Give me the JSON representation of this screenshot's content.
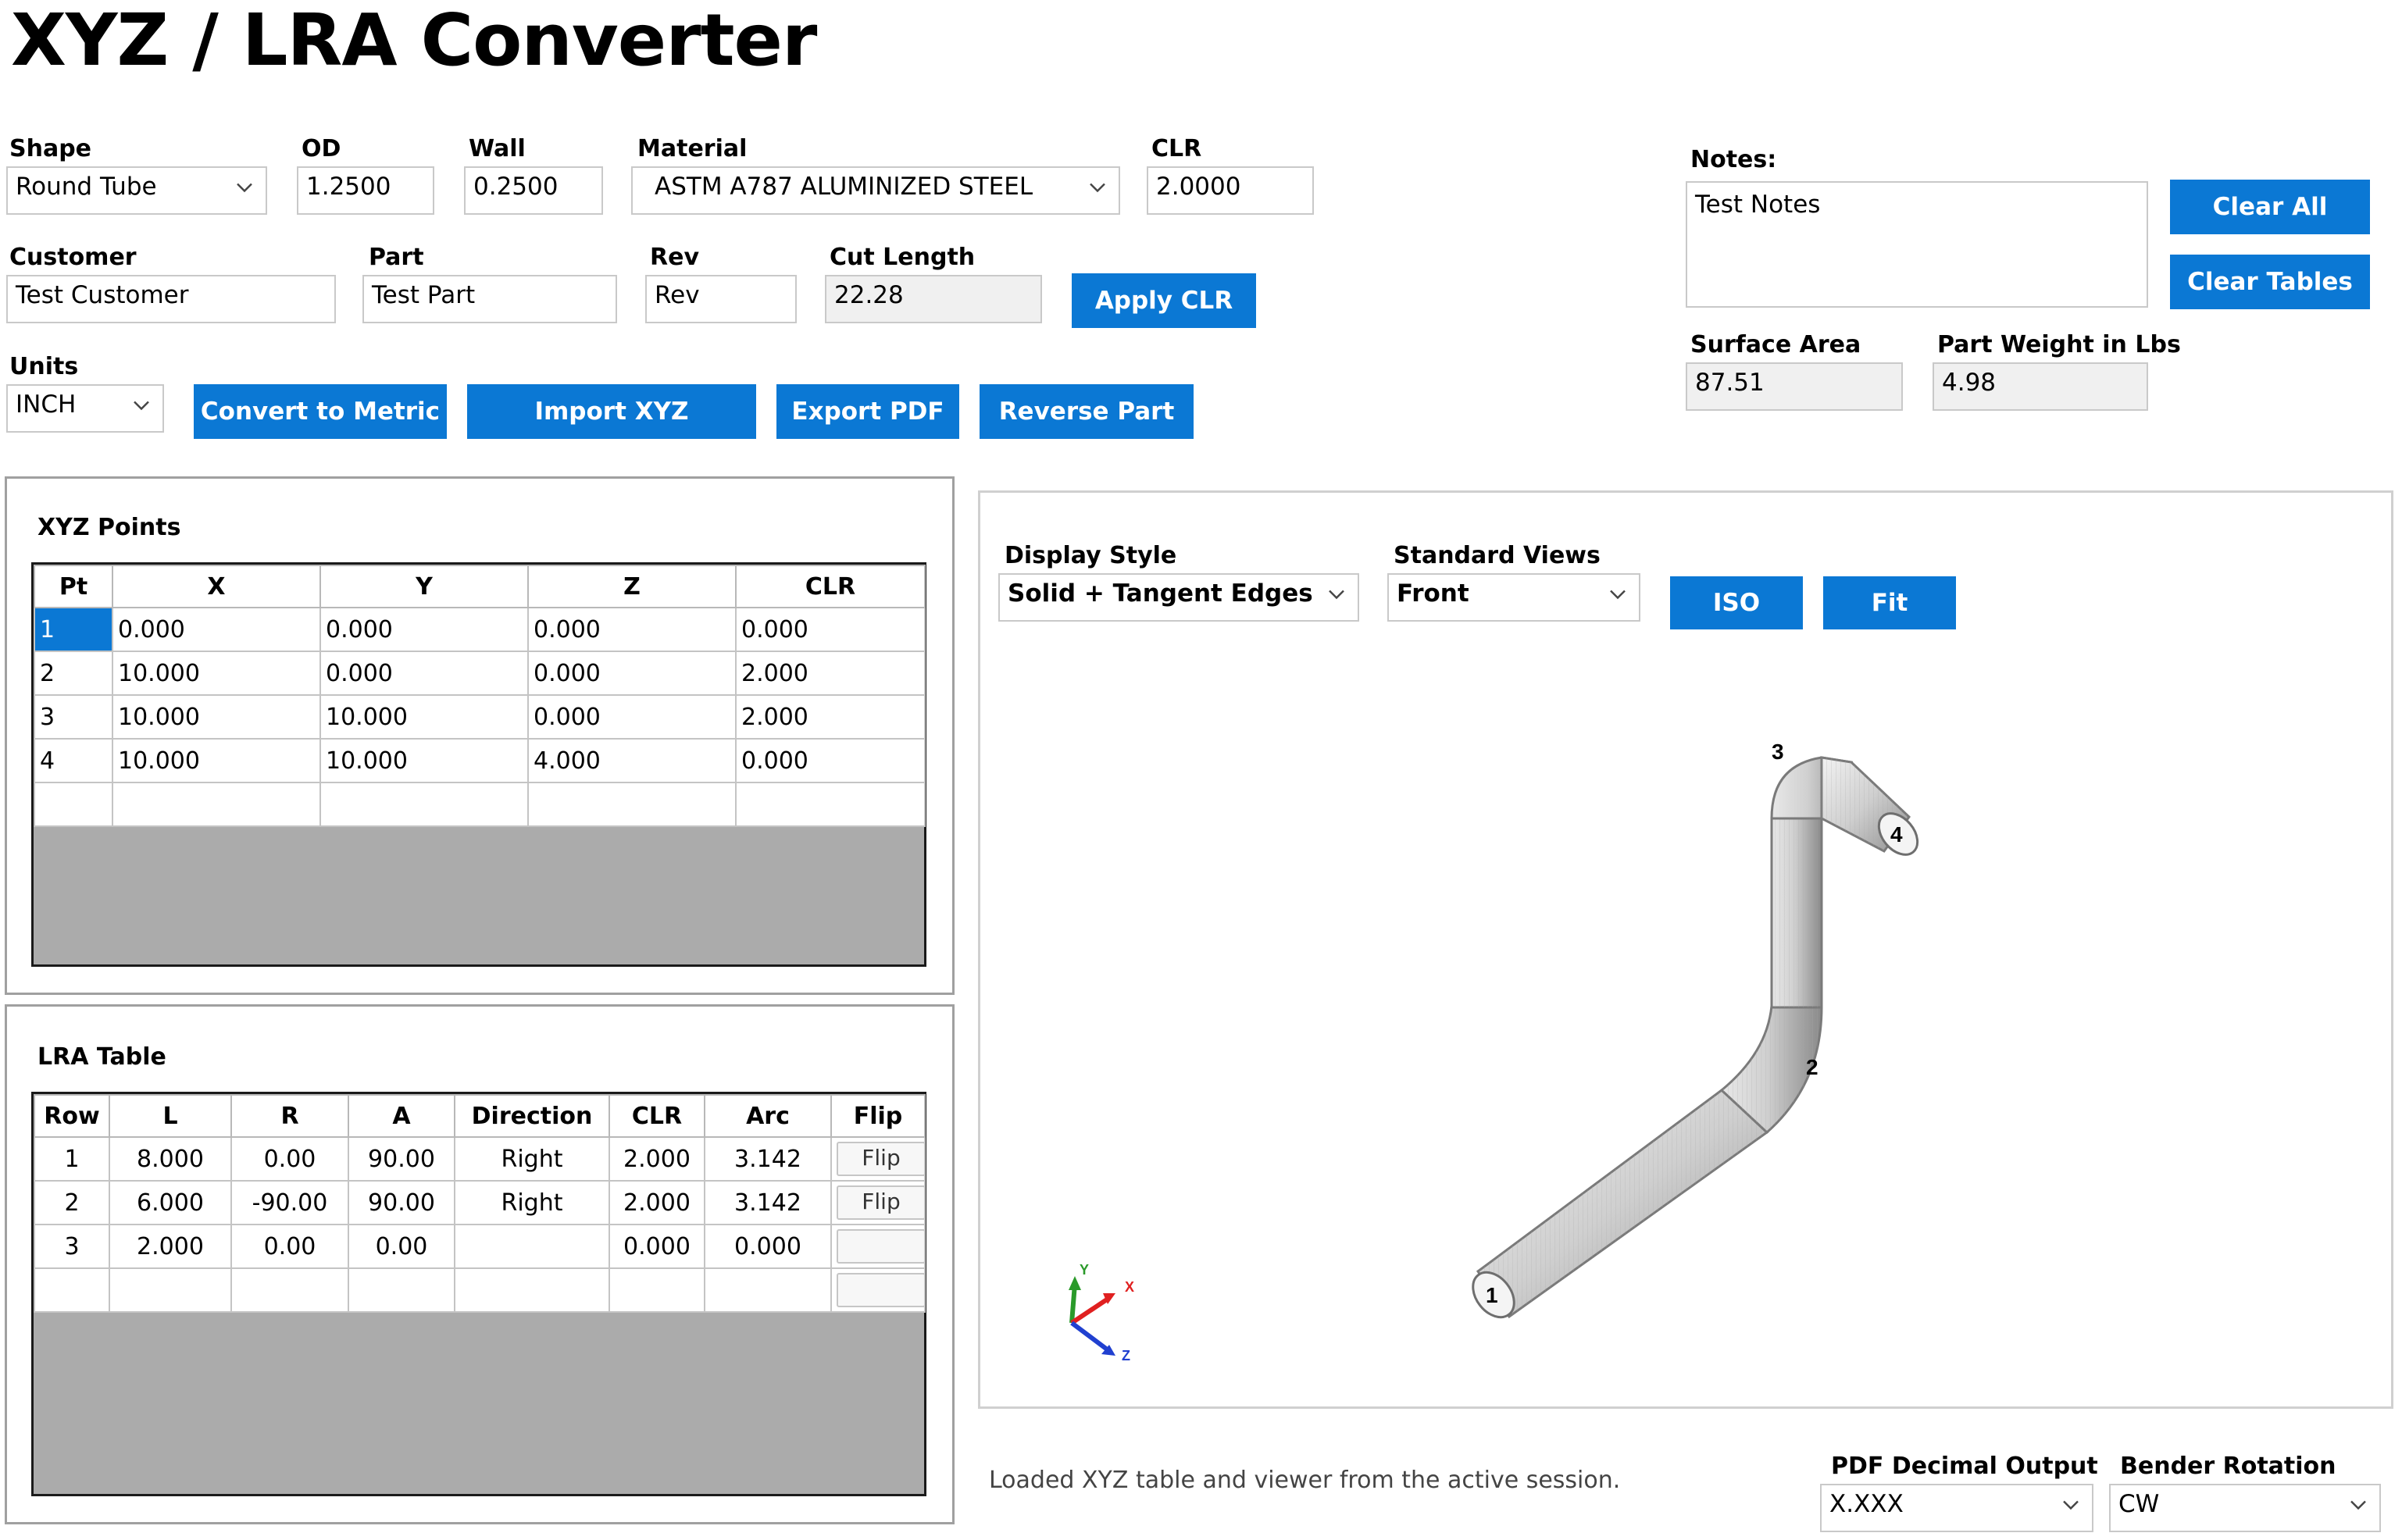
{
  "app": {
    "title": "XYZ / LRA Converter"
  },
  "form": {
    "shape": {
      "label": "Shape",
      "value": "Round Tube"
    },
    "od": {
      "label": "OD",
      "value": "1.2500"
    },
    "wall": {
      "label": "Wall",
      "value": "0.2500"
    },
    "material": {
      "label": "Material",
      "value": "ASTM A787 ALUMINIZED STEEL"
    },
    "clr": {
      "label": "CLR",
      "value": "2.0000"
    },
    "customer": {
      "label": "Customer",
      "value": "Test Customer"
    },
    "part": {
      "label": "Part",
      "value": "Test Part"
    },
    "rev": {
      "label": "Rev",
      "value": "Rev"
    },
    "cut_length": {
      "label": "Cut Length",
      "value": "22.28"
    },
    "units": {
      "label": "Units",
      "value": "INCH"
    }
  },
  "buttons": {
    "apply_clr": "Apply CLR",
    "convert_metric": "Convert to Metric",
    "import_xyz": "Import XYZ",
    "export_pdf": "Export PDF",
    "reverse_part": "Reverse Part",
    "clear_all": "Clear All",
    "clear_tables": "Clear Tables",
    "iso": "ISO",
    "fit": "Fit"
  },
  "notes": {
    "label": "Notes:",
    "value": "Test Notes"
  },
  "surface_area": {
    "label": "Surface Area",
    "value": "87.51"
  },
  "part_weight": {
    "label": "Part Weight in Lbs",
    "value": "4.98"
  },
  "xyz_table": {
    "title": "XYZ Points",
    "headers": [
      "Pt",
      "X",
      "Y",
      "Z",
      "CLR"
    ],
    "rows": [
      [
        "1",
        "0.000",
        "0.000",
        "0.000",
        "0.000"
      ],
      [
        "2",
        "10.000",
        "0.000",
        "0.000",
        "2.000"
      ],
      [
        "3",
        "10.000",
        "10.000",
        "0.000",
        "2.000"
      ],
      [
        "4",
        "10.000",
        "10.000",
        "4.000",
        "0.000"
      ]
    ]
  },
  "lra_table": {
    "title": "LRA Table",
    "headers": [
      "Row",
      "L",
      "R",
      "A",
      "Direction",
      "CLR",
      "Arc",
      "Flip"
    ],
    "rows": [
      {
        "cells": [
          "1",
          "8.000",
          "0.00",
          "90.00",
          "Right",
          "2.000",
          "3.142"
        ],
        "flip": "Flip"
      },
      {
        "cells": [
          "2",
          "6.000",
          "-90.00",
          "90.00",
          "Right",
          "2.000",
          "3.142"
        ],
        "flip": "Flip"
      },
      {
        "cells": [
          "3",
          "2.000",
          "0.00",
          "0.00",
          "",
          "0.000",
          "0.000"
        ],
        "flip": ""
      }
    ]
  },
  "viewer": {
    "display_style": {
      "label": "Display Style",
      "value": "Solid + Tangent Edges"
    },
    "standard_views": {
      "label": "Standard Views",
      "value": "Front"
    },
    "point_labels": [
      "1",
      "2",
      "3",
      "4"
    ],
    "axes": {
      "x": "X",
      "y": "Y",
      "z": "Z"
    }
  },
  "status": {
    "text": "Loaded XYZ table and viewer from the active session."
  },
  "pdf_decimal": {
    "label": "PDF Decimal Output",
    "value": "X.XXX"
  },
  "bender_rotation": {
    "label": "Bender Rotation",
    "value": "CW"
  }
}
